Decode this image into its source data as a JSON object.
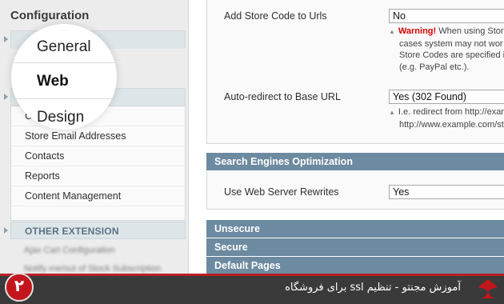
{
  "sidebar": {
    "title": "Configuration",
    "general_items": [
      "Currency Setup",
      "Store Email Addresses",
      "Contacts",
      "Reports",
      "Content Management"
    ],
    "extension_header": "OTHER EXTENSION",
    "extension_items": [
      "Ajax Cart Configuration",
      "Notify me/out of Stock Subscription"
    ]
  },
  "zoom": {
    "general": "General",
    "web": "Web",
    "design": "Design"
  },
  "form": {
    "store_code_label": "Add Store Code to Urls",
    "store_code_value": "No",
    "warning_bold": "Warning!",
    "warning_lines": [
      " When using Store",
      "cases system may not wor",
      "Store Codes are specified i",
      "(e.g. PayPal etc.)."
    ],
    "redirect_label": "Auto-redirect to Base URL",
    "redirect_value": "Yes (302 Found)",
    "redirect_note_lines": [
      "I.e. redirect from http://exam",
      "http://www.example.com/st"
    ],
    "seo_header": "Search Engines Optimization",
    "rewrites_label": "Use Web Server Rewrites",
    "rewrites_value": "Yes",
    "sections": [
      "Unsecure",
      "Secure",
      "Default Pages"
    ]
  },
  "banner": {
    "number": "۲",
    "text": "آموزش مجنتو - تنظیم ssl برای فروشگاه",
    "colors": {
      "accent": "#c3161c",
      "bar": "#3a3a3a"
    }
  }
}
